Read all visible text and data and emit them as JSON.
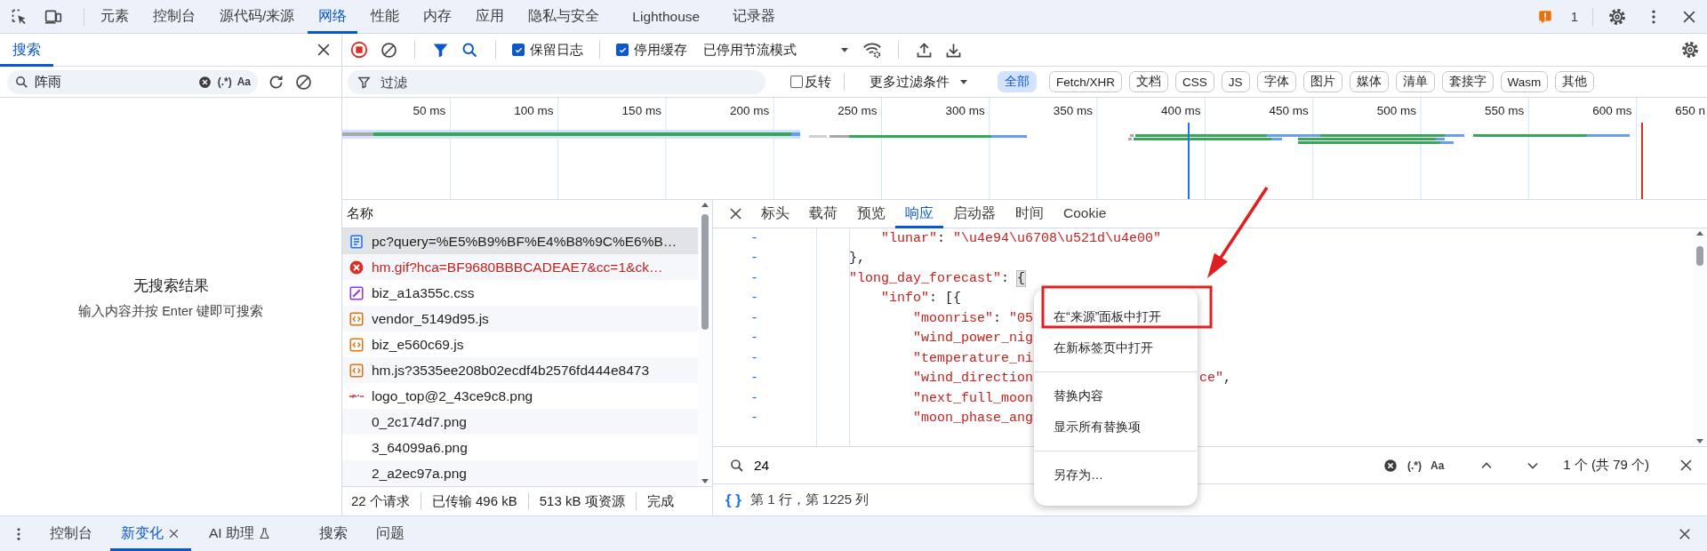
{
  "top_tabs": [
    {
      "label": "元素",
      "selected": false
    },
    {
      "label": "控制台",
      "selected": false
    },
    {
      "label": "源代码/来源",
      "selected": false
    },
    {
      "label": "网络",
      "selected": true
    },
    {
      "label": "性能",
      "selected": false
    },
    {
      "label": "内存",
      "selected": false
    },
    {
      "label": "应用",
      "selected": false
    },
    {
      "label": "隐私与安全",
      "selected": false
    },
    {
      "label": "Lighthouse",
      "selected": false
    },
    {
      "label": "记录器",
      "selected": false
    }
  ],
  "issues": {
    "count": "1"
  },
  "search_panel": {
    "tab": {
      "label": "搜索",
      "selected": true
    },
    "query": "阵雨",
    "regex": "(.*)",
    "case": "Aa",
    "empty_title": "无搜索结果",
    "empty_hint": "输入内容并按 Enter 键即可搜索"
  },
  "toolbar": {
    "recording": true,
    "filter_on": true,
    "preserve_log": {
      "label": "保留日志",
      "checked": true
    },
    "disable_cache": {
      "label": "停用缓存",
      "checked": true
    },
    "throttling": "已停用节流模式"
  },
  "filter": {
    "placeholder": "过滤",
    "invert": {
      "label": "反转",
      "checked": false
    },
    "more": "更多过滤条件",
    "types": [
      {
        "label": "全部",
        "selected": true
      },
      {
        "label": "Fetch/XHR",
        "selected": false
      },
      {
        "label": "文档",
        "selected": false
      },
      {
        "label": "CSS",
        "selected": false
      },
      {
        "label": "JS",
        "selected": false
      },
      {
        "label": "字体",
        "selected": false
      },
      {
        "label": "图片",
        "selected": false
      },
      {
        "label": "媒体",
        "selected": false
      },
      {
        "label": "清单",
        "selected": false
      },
      {
        "label": "套接字",
        "selected": false
      },
      {
        "label": "Wasm",
        "selected": false
      },
      {
        "label": "其他",
        "selected": false
      }
    ]
  },
  "overview": {
    "ticks": [
      "50 ms",
      "100 ms",
      "150 ms",
      "200 ms",
      "250 ms",
      "300 ms",
      "350 ms",
      "400 ms",
      "450 ms",
      "500 ms",
      "550 ms",
      "600 ms",
      "650 n"
    ]
  },
  "requests": {
    "column": "名称",
    "rows": [
      {
        "name": "pc?query=%E5%B9%BF%E4%B8%9C%E6%B…",
        "kind": "document",
        "selected": true,
        "failed": false
      },
      {
        "name": "hm.gif?hca=BF9680BBBCADEAE7&cc=1&ck…",
        "kind": "error",
        "selected": false,
        "failed": true
      },
      {
        "name": "biz_a1a355c.css",
        "kind": "stylesheet",
        "selected": false,
        "failed": false
      },
      {
        "name": "vendor_5149d95.js",
        "kind": "script",
        "selected": false,
        "failed": false
      },
      {
        "name": "biz_e560c69.js",
        "kind": "script",
        "selected": false,
        "failed": false
      },
      {
        "name": "hm.js?3535ee208b02ecdf4b2576fd444e8473",
        "kind": "script",
        "selected": false,
        "failed": false
      },
      {
        "name": "logo_top@2_43ce9c8.png",
        "kind": "image",
        "selected": false,
        "failed": false
      },
      {
        "name": "0_2c174d7.png",
        "kind": "blank",
        "selected": false,
        "failed": false
      },
      {
        "name": "3_64099a6.png",
        "kind": "blank",
        "selected": false,
        "failed": false
      },
      {
        "name": "2_a2ec97a.png",
        "kind": "blank",
        "selected": false,
        "failed": false
      }
    ],
    "summary": [
      "22 个请求",
      "已传输 496 kB",
      "513 kB 项资源",
      "完成"
    ]
  },
  "detail": {
    "tabs": [
      {
        "label": "标头",
        "selected": false
      },
      {
        "label": "载荷",
        "selected": false
      },
      {
        "label": "预览",
        "selected": false
      },
      {
        "label": "响应",
        "selected": true
      },
      {
        "label": "启动器",
        "selected": false
      },
      {
        "label": "时间",
        "selected": false
      },
      {
        "label": "Cookie",
        "selected": false
      }
    ],
    "lines": [
      {
        "marker": "-",
        "text": "            \"lunar\": \"\\u4e94\\u6708\\u521d\\u4e00\"",
        "bracket_highlight": false
      },
      {
        "marker": "-",
        "text": "        },",
        "bracket_highlight": false
      },
      {
        "marker": "-",
        "text": "        \"long_day_forecast\": {",
        "bracket_highlight": true
      },
      {
        "marker": "-",
        "text": "            \"info\": [{",
        "bracket_highlight": false
      },
      {
        "marker": "-",
        "text": "                \"moonrise\": \"05",
        "bracket_highlight": false
      },
      {
        "marker": "-",
        "text": "                \"wind_power_nig",
        "bracket_highlight": false
      },
      {
        "marker": "-",
        "text": "                \"temperature_ni",
        "bracket_highlight": false
      },
      {
        "marker": "-",
        "text": "                \"wind_direction",
        "tail": "ce\",",
        "bracket_highlight": false
      },
      {
        "marker": "-",
        "text": "                \"next_full_moon",
        "bracket_highlight": false
      },
      {
        "marker": "-",
        "text": "                \"moon_phase_ang",
        "bracket_highlight": false
      }
    ],
    "search": {
      "query": "24",
      "regex": "(.*)",
      "case": "Aa",
      "matches": "1 个 (共 79 个)"
    },
    "pretty_print": "{ }",
    "position": "第 1 行，第 1225 列"
  },
  "context_menu": {
    "items": [
      {
        "kind": "item",
        "label": "在“来源”面板中打开",
        "highlighted": true
      },
      {
        "kind": "item",
        "label": "在新标签页中打开",
        "highlighted": false
      },
      {
        "kind": "separator"
      },
      {
        "kind": "item",
        "label": "替换内容",
        "highlighted": false
      },
      {
        "kind": "item",
        "label": "显示所有替换项",
        "highlighted": false
      },
      {
        "kind": "separator"
      },
      {
        "kind": "item",
        "label": "另存为…",
        "highlighted": false
      }
    ]
  },
  "drawer": {
    "tabs": [
      {
        "label": "控制台",
        "selected": false,
        "closable": false,
        "experimental": false
      },
      {
        "label": "新变化",
        "selected": true,
        "closable": true,
        "experimental": false
      },
      {
        "label": "AI 助理",
        "selected": false,
        "closable": false,
        "experimental": true
      },
      {
        "label": "搜索",
        "selected": false,
        "closable": false,
        "experimental": false
      },
      {
        "label": "问题",
        "selected": false,
        "closable": false,
        "experimental": false
      }
    ]
  }
}
